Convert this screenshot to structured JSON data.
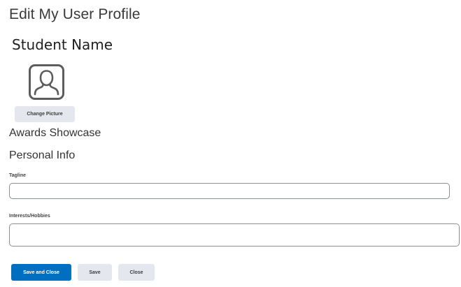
{
  "header": {
    "title": "Edit My User Profile",
    "student_name": "Student Name"
  },
  "profile_picture": {
    "icon": "user-silhouette-icon",
    "change_label": "Change Picture"
  },
  "sections": {
    "awards": "Awards Showcase",
    "personal_info": "Personal Info"
  },
  "fields": {
    "tagline": {
      "label": "Tagline",
      "value": "",
      "placeholder": ""
    },
    "interests": {
      "label": "Interests/Hobbies",
      "value": "",
      "placeholder": ""
    }
  },
  "actions": {
    "save_and_close": "Save and Close",
    "save": "Save",
    "close": "Close"
  },
  "colors": {
    "primary_button": "#006fbf",
    "secondary_button": "#e4e8ee"
  }
}
